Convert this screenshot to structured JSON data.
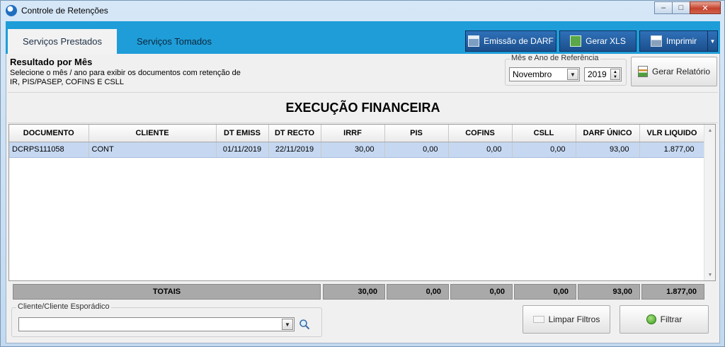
{
  "window": {
    "title": "Controle de Retenções",
    "buttons": {
      "minimize": "‒",
      "maximize": "□",
      "close": "✕"
    }
  },
  "tabs": [
    {
      "label": "Serviços Prestados",
      "active": true
    },
    {
      "label": "Serviços Tomados",
      "active": false
    }
  ],
  "toolbar": {
    "darf_label": "Emissão de DARF",
    "xls_label": "Gerar XLS",
    "print_label": "Imprimir"
  },
  "result": {
    "title": "Resultado por Mês",
    "description": "Selecione o mês / ano para exibir os documentos com retenção de IR, PIS/PASEP, COFINS E CSLL"
  },
  "reference": {
    "group_label": "Mês e Ano de Referência",
    "month": "Novembro",
    "year": "2019"
  },
  "report_button": "Gerar Relatório",
  "section_title": "EXECUÇÃO FINANCEIRA",
  "table": {
    "columns": [
      "DOCUMENTO",
      "CLIENTE",
      "DT EMISS",
      "DT RECTO",
      "IRRF",
      "PIS",
      "COFINS",
      "CSLL",
      "DARF ÚNICO",
      "VLR LIQUIDO"
    ],
    "rows": [
      [
        "DCRPS111058",
        "CONT",
        "01/11/2019",
        "22/11/2019",
        "30,00",
        "0,00",
        "0,00",
        "0,00",
        "93,00",
        "1.877,00"
      ]
    ]
  },
  "totals": {
    "label": "TOTAIS",
    "irrf": "30,00",
    "pis": "0,00",
    "cofins": "0,00",
    "csll": "0,00",
    "darf": "93,00",
    "liquido": "1.877,00"
  },
  "client_filter": {
    "group_label": "Cliente/Cliente Esporádico",
    "value": ""
  },
  "filters": {
    "clear_label": "Limpar Filtros",
    "apply_label": "Filtrar"
  },
  "colors": {
    "tab_bar": "#1e9dd8",
    "toolbar_button": "#1c4f8d",
    "selected_row": "#c6d8f1",
    "totals_bg": "#a9a9a9"
  }
}
